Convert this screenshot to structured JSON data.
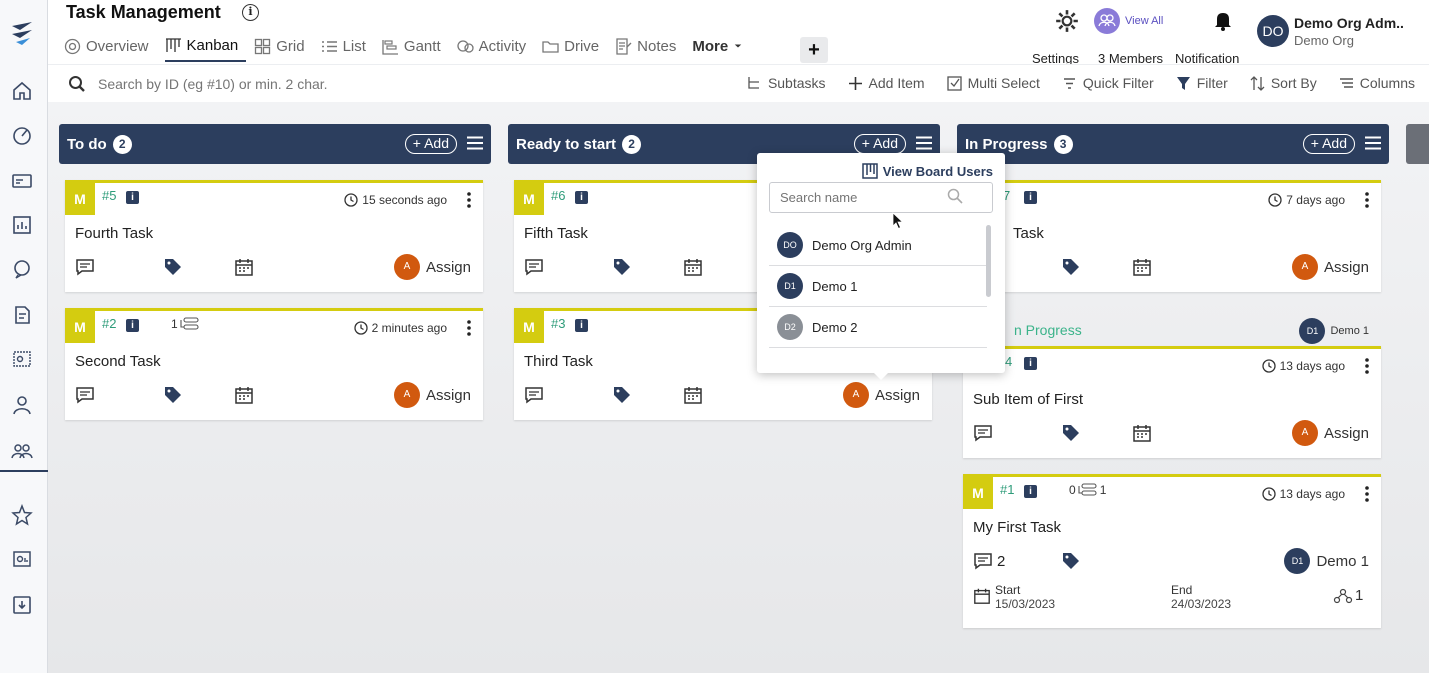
{
  "header": {
    "title": "Task Management",
    "tabs": [
      {
        "label": "Overview",
        "icon": "overview-icon"
      },
      {
        "label": "Kanban",
        "icon": "kanban-icon",
        "active": true
      },
      {
        "label": "Grid",
        "icon": "grid-icon"
      },
      {
        "label": "List",
        "icon": "list-icon"
      },
      {
        "label": "Gantt",
        "icon": "gantt-icon"
      },
      {
        "label": "Activity",
        "icon": "activity-icon"
      },
      {
        "label": "Drive",
        "icon": "folder-icon"
      },
      {
        "label": "Notes",
        "icon": "notes-icon"
      },
      {
        "label": "More",
        "icon": "chevron-down-icon"
      }
    ],
    "plus": "+",
    "settings_label": "Settings",
    "view_all": "View All",
    "members_label": "3 Members",
    "notification_label": "Notification",
    "org": {
      "initials": "DO",
      "name": "Demo Org Adm..",
      "sub": "Demo Org"
    }
  },
  "toolbar": {
    "search_placeholder": "Search by ID (eg #10) or min. 2 char.",
    "actions": [
      "Subtasks",
      "Add Item",
      "Multi Select",
      "Quick Filter",
      "Filter",
      "Sort By",
      "Columns"
    ]
  },
  "columns": [
    {
      "title": "To do",
      "count": "2",
      "add": "+ Add",
      "cards": [
        {
          "badge": "M",
          "id": "#5",
          "time": "15 seconds ago",
          "title": "Fourth Task",
          "assign": "Assign",
          "avatar": "A"
        },
        {
          "badge": "M",
          "id": "#2",
          "subtasks": "1",
          "time": "2 minutes ago",
          "title": "Second Task",
          "assign": "Assign",
          "avatar": "A"
        }
      ]
    },
    {
      "title": "Ready to start",
      "count": "2",
      "add": "+ Add",
      "cards": [
        {
          "badge": "M",
          "id": "#6",
          "title": "Fifth Task"
        },
        {
          "badge": "M",
          "id": "#3",
          "title": "Third Task",
          "assign": "Assign",
          "avatar": "A"
        }
      ]
    },
    {
      "title": "In Progress",
      "count": "3",
      "add": "+ Add",
      "cards": [
        {
          "id": "7",
          "time": "7 days ago",
          "title": "Task",
          "assign": "Assign",
          "avatar": "A"
        },
        {
          "group_label": "n Progress",
          "group_user": "Demo 1",
          "group_avatar": "D1",
          "id": "4",
          "time": "13 days ago",
          "title": "Sub Item of First",
          "assign": "Assign",
          "avatar": "A"
        },
        {
          "badge": "M",
          "id": "#1",
          "subtasks_done": "0",
          "subtasks": "1",
          "time": "13 days ago",
          "title": "My First Task",
          "comments": "2",
          "assignee": "Demo 1",
          "assignee_avatar": "D1",
          "start_label": "Start",
          "start": "15/03/2023",
          "end_label": "End",
          "end": "24/03/2023",
          "deps": "1"
        }
      ]
    }
  ],
  "popup": {
    "title": "View Board Users",
    "search_placeholder": "Search name",
    "users": [
      {
        "initials": "DO",
        "name": "Demo Org Admin",
        "color": "#2c3e5e"
      },
      {
        "initials": "D1",
        "name": "Demo 1",
        "color": "#2c3e5e"
      },
      {
        "initials": "D2",
        "name": "Demo 2",
        "color": "#8a8f96"
      }
    ]
  },
  "colors": {
    "primary": "#2c3e5e",
    "badge": "#d4cc10",
    "avatar": "#d1590f",
    "id": "#2e9c7a"
  }
}
